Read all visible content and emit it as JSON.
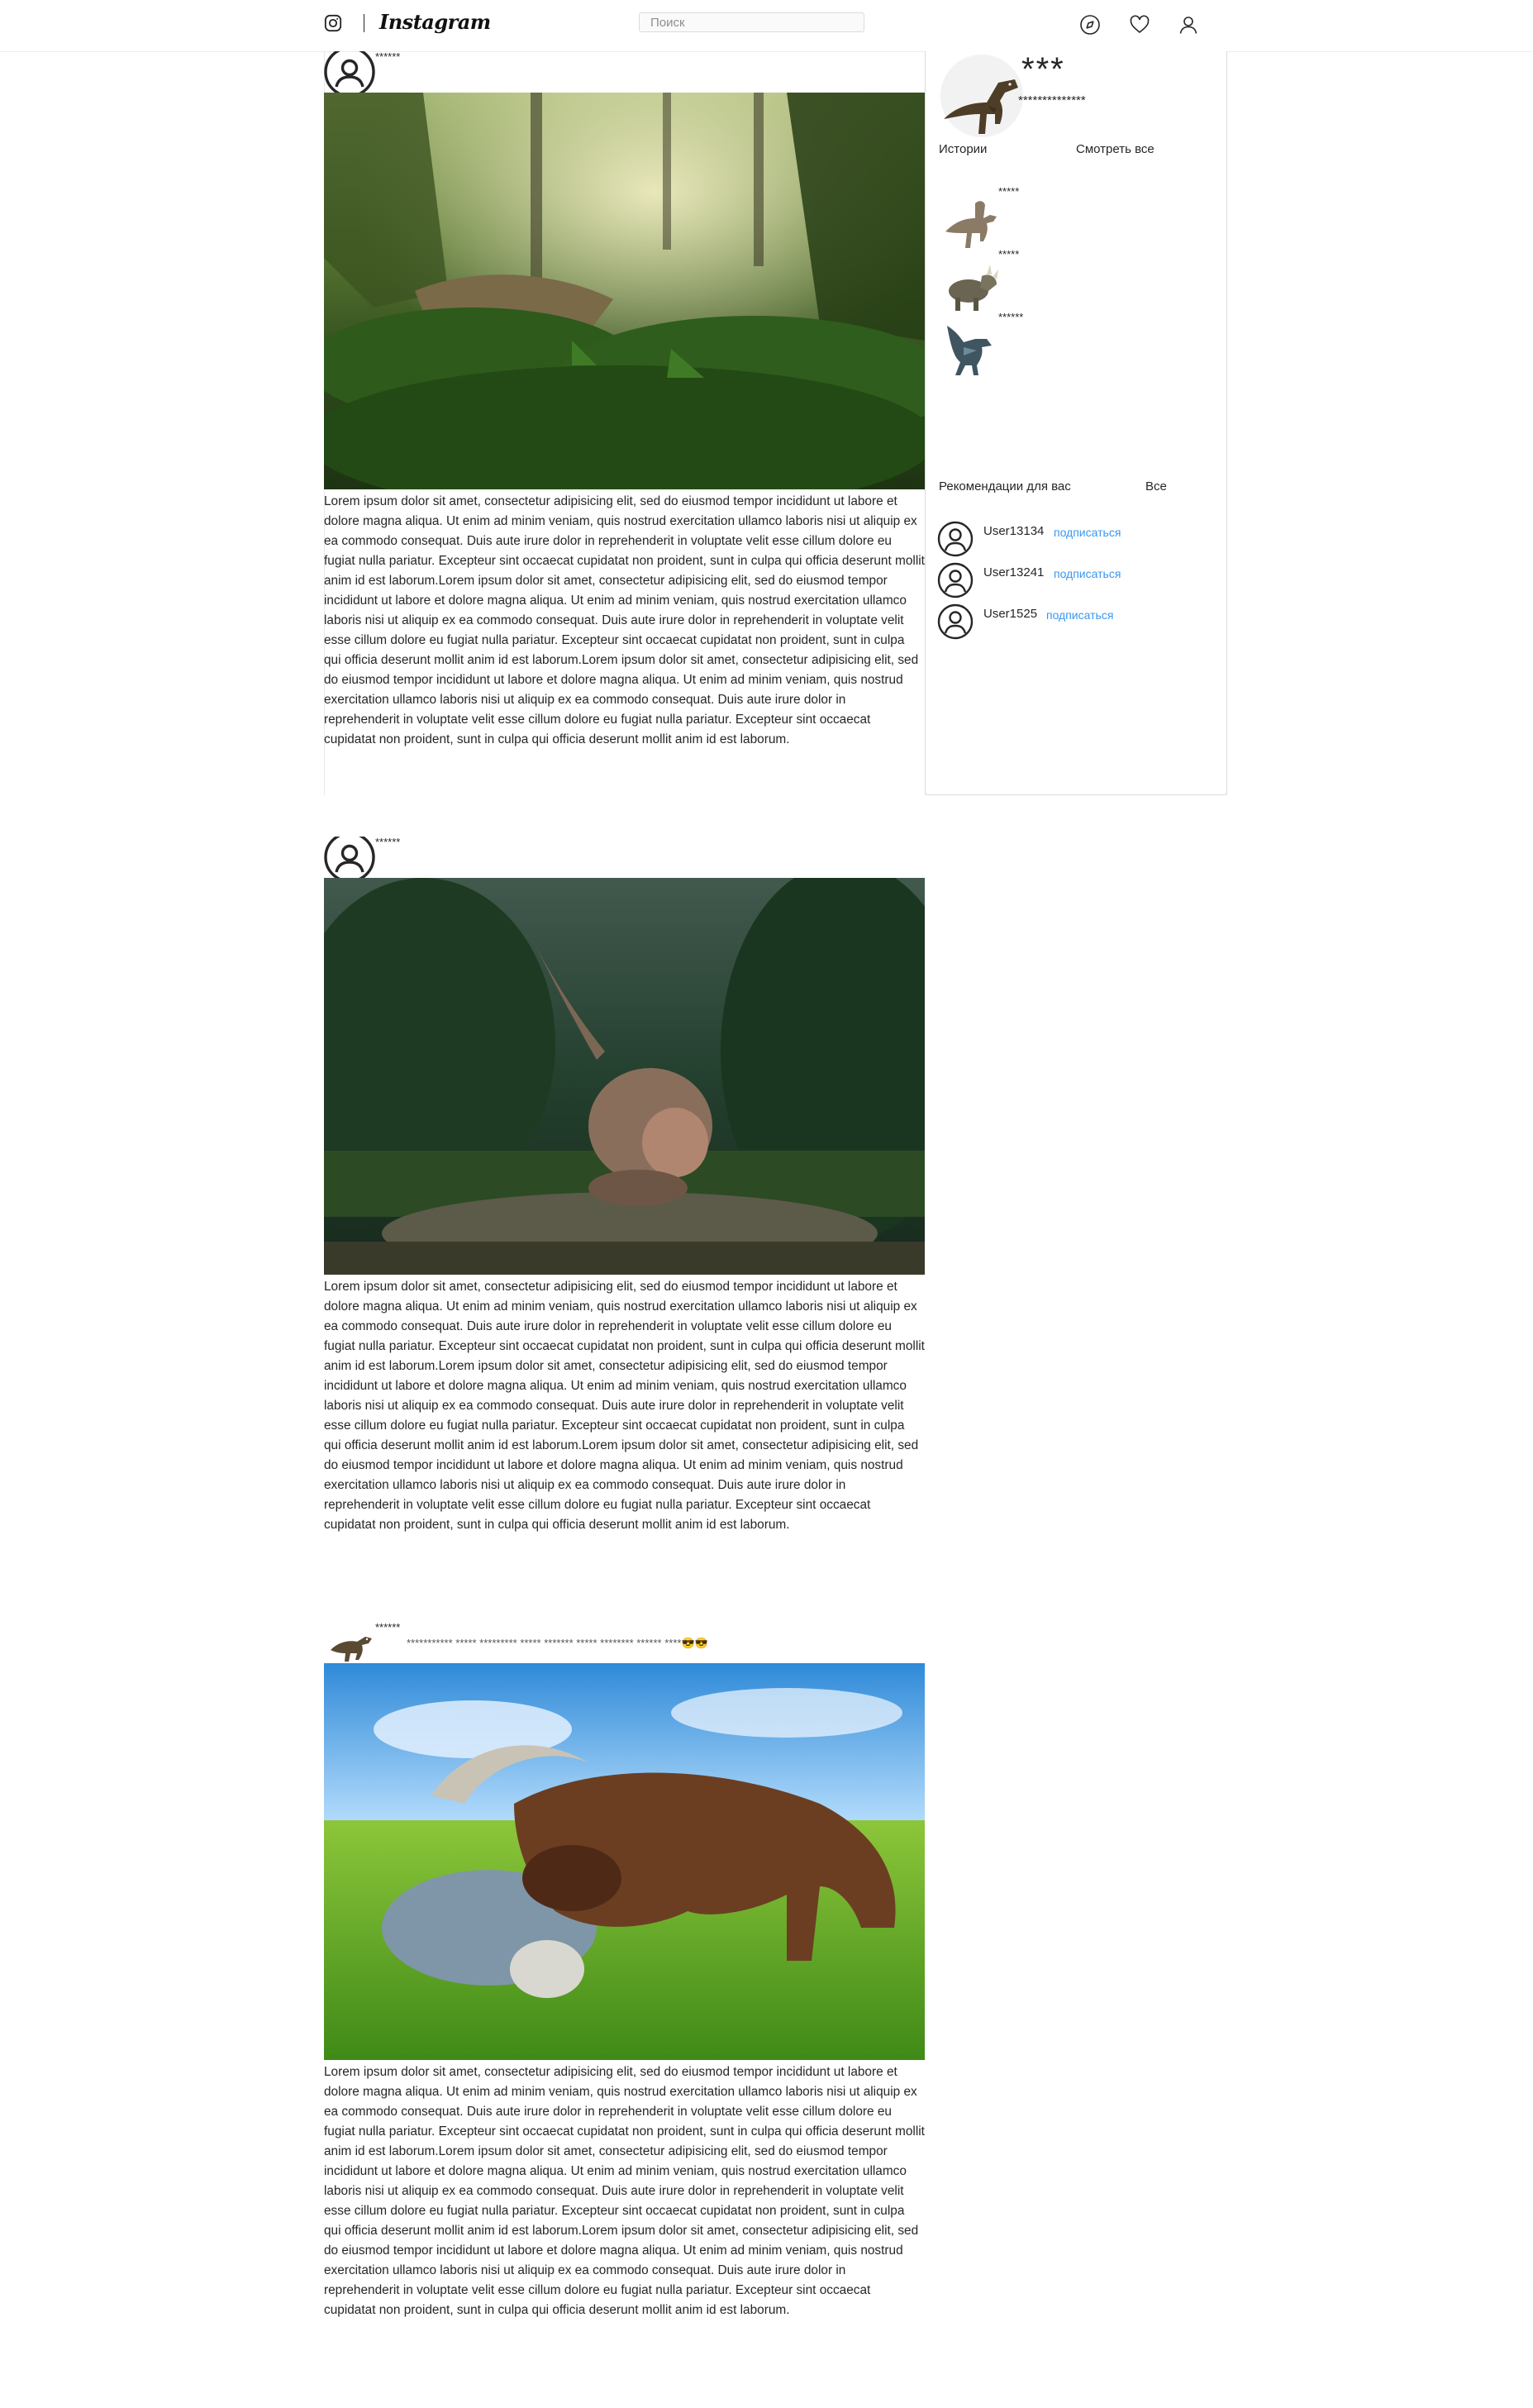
{
  "header": {
    "brand": "Instagram",
    "search_placeholder": "Поиск"
  },
  "posts": [
    {
      "username": "******",
      "hashtags": "",
      "text": "Lorem ipsum dolor sit amet, consectetur adipisicing elit, sed do eiusmod tempor incididunt ut labore et dolore magna aliqua. Ut enim ad minim veniam, quis nostrud exercitation ullamco laboris nisi ut aliquip ex ea commodo consequat. Duis aute irure dolor in reprehenderit in voluptate velit esse cillum dolore eu fugiat nulla pariatur. Excepteur sint occaecat cupidatat non proident, sunt in culpa qui officia deserunt mollit anim id est laborum.Lorem ipsum dolor sit amet, consectetur adipisicing elit, sed do eiusmod tempor incididunt ut labore et dolore magna aliqua. Ut enim ad minim veniam, quis nostrud exercitation ullamco laboris nisi ut aliquip ex ea commodo consequat. Duis aute irure dolor in reprehenderit in voluptate velit esse cillum dolore eu fugiat nulla pariatur. Excepteur sint occaecat cupidatat non proident, sunt in culpa qui officia deserunt mollit anim id est laborum.Lorem ipsum dolor sit amet, consectetur adipisicing elit, sed do eiusmod tempor incididunt ut labore et dolore magna aliqua. Ut enim ad minim veniam, quis nostrud exercitation ullamco laboris nisi ut aliquip ex ea commodo consequat. Duis aute irure dolor in reprehenderit in voluptate velit esse cillum dolore eu fugiat nulla pariatur. Excepteur sint occaecat cupidatat non proident, sunt in culpa qui officia deserunt mollit anim id est laborum."
    },
    {
      "username": "******",
      "hashtags": "",
      "text": "Lorem ipsum dolor sit amet, consectetur adipisicing elit, sed do eiusmod tempor incididunt ut labore et dolore magna aliqua. Ut enim ad minim veniam, quis nostrud exercitation ullamco laboris nisi ut aliquip ex ea commodo consequat. Duis aute irure dolor in reprehenderit in voluptate velit esse cillum dolore eu fugiat nulla pariatur. Excepteur sint occaecat cupidatat non proident, sunt in culpa qui officia deserunt mollit anim id est laborum.Lorem ipsum dolor sit amet, consectetur adipisicing elit, sed do eiusmod tempor incididunt ut labore et dolore magna aliqua. Ut enim ad minim veniam, quis nostrud exercitation ullamco laboris nisi ut aliquip ex ea commodo consequat. Duis aute irure dolor in reprehenderit in voluptate velit esse cillum dolore eu fugiat nulla pariatur. Excepteur sint occaecat cupidatat non proident, sunt in culpa qui officia deserunt mollit anim id est laborum.Lorem ipsum dolor sit amet, consectetur adipisicing elit, sed do eiusmod tempor incididunt ut labore et dolore magna aliqua. Ut enim ad minim veniam, quis nostrud exercitation ullamco laboris nisi ut aliquip ex ea commodo consequat. Duis aute irure dolor in reprehenderit in voluptate velit esse cillum dolore eu fugiat nulla pariatur. Excepteur sint occaecat cupidatat non proident, sunt in culpa qui officia deserunt mollit anim id est laborum."
    },
    {
      "username": "******",
      "hashtags": "*********** ***** ********* ***** ******* ***** ******** ****** ****😎😎",
      "text": "Lorem ipsum dolor sit amet, consectetur adipisicing elit, sed do eiusmod tempor incididunt ut labore et dolore magna aliqua. Ut enim ad minim veniam, quis nostrud exercitation ullamco laboris nisi ut aliquip ex ea commodo consequat. Duis aute irure dolor in reprehenderit in voluptate velit esse cillum dolore eu fugiat nulla pariatur. Excepteur sint occaecat cupidatat non proident, sunt in culpa qui officia deserunt mollit anim id est laborum.Lorem ipsum dolor sit amet, consectetur adipisicing elit, sed do eiusmod tempor incididunt ut labore et dolore magna aliqua. Ut enim ad minim veniam, quis nostrud exercitation ullamco laboris nisi ut aliquip ex ea commodo consequat. Duis aute irure dolor in reprehenderit in voluptate velit esse cillum dolore eu fugiat nulla pariatur. Excepteur sint occaecat cupidatat non proident, sunt in culpa qui officia deserunt mollit anim id est laborum.Lorem ipsum dolor sit amet, consectetur adipisicing elit, sed do eiusmod tempor incididunt ut labore et dolore magna aliqua. Ut enim ad minim veniam, quis nostrud exercitation ullamco laboris nisi ut aliquip ex ea commodo consequat. Duis aute irure dolor in reprehenderit in voluptate velit esse cillum dolore eu fugiat nulla pariatur. Excepteur sint occaecat cupidatat non proident, sunt in culpa qui officia deserunt mollit anim id est laborum."
    }
  ],
  "sidebar": {
    "profile_name": "***",
    "profile_subtitle": "**************",
    "stories_title": "Истории",
    "stories_all": "Смотреть все",
    "stories": [
      {
        "name": "*****"
      },
      {
        "name": "*****"
      },
      {
        "name": "******"
      }
    ],
    "recommendations_title": "Рекомендации для вас",
    "recommendations_all": "Все",
    "recommendations": [
      {
        "name": "User13134",
        "action": "подписаться"
      },
      {
        "name": "User13241",
        "action": "подписаться"
      },
      {
        "name": "User1525",
        "action": "подписаться"
      }
    ]
  },
  "colors": {
    "link": "#3897f0",
    "text": "#262626",
    "border": "#dbdbdb"
  },
  "icons": [
    "instagram-logo-icon",
    "explore-compass-icon",
    "heart-icon",
    "profile-icon",
    "user-avatar-icon",
    "dinosaur-avatar-icon"
  ]
}
